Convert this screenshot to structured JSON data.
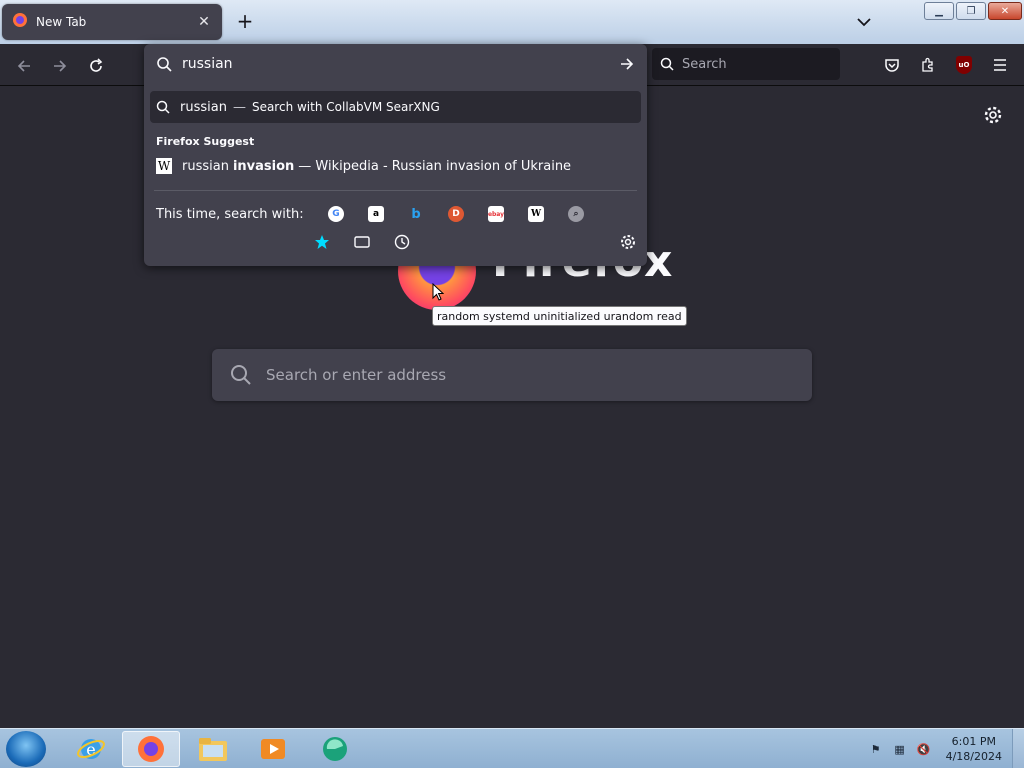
{
  "tab": {
    "title": "New Tab",
    "close": "✕"
  },
  "new_tab": "+",
  "toolbar": {
    "search_placeholder": "Search"
  },
  "urlbar": {
    "value": "russian",
    "suggestion_query": "russian",
    "suggestion_sep": "—",
    "suggestion_action": "Search with CollabVM SearXNG",
    "group_label": "Firefox Suggest",
    "wiki_prefix": "russian",
    "wiki_bold": "invasion",
    "wiki_rest": "— Wikipedia - Russian invasion of Ukraine",
    "oneoff_label": "This time, search with:",
    "engines": [
      "google-icon",
      "amazon-icon",
      "bing-icon",
      "duckduckgo-icon",
      "ebay-icon",
      "wikipedia-icon",
      "searxng-icon"
    ],
    "modes": [
      "bookmarks-icon",
      "tabs-icon",
      "history-icon"
    ]
  },
  "page": {
    "wordmark": "Firefox",
    "search_placeholder": "Search or enter address",
    "tooltip": "random systemd uninitialized urandom read"
  },
  "taskbar": {
    "time": "6:01 PM",
    "date": "4/18/2024"
  }
}
